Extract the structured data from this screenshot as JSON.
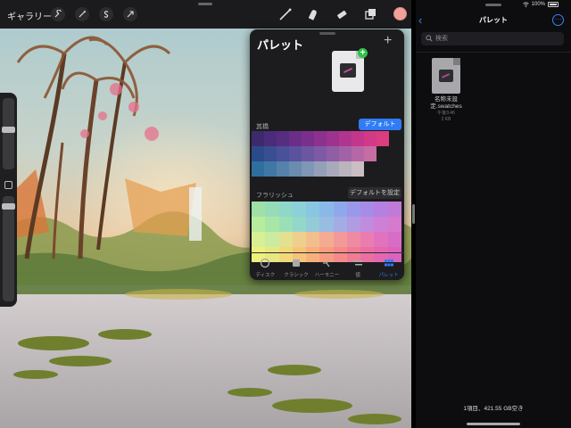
{
  "canvas_app": {
    "gallery_label": "ギャラリー",
    "actions_icons": [
      "wrench-icon",
      "magic-wand-icon",
      "selection-s-icon",
      "transform-arrow-icon"
    ],
    "tools_icons": [
      "brush-icon",
      "smudge-icon",
      "eraser-icon",
      "layers-icon"
    ],
    "current_color": "#f0a29a"
  },
  "palette_panel": {
    "title": "パレット",
    "add_symbol": "+",
    "section1_label": "其橋",
    "section1_button": "デフォルト",
    "section2_label": "フラリッシュ",
    "section2_button": "デフォルトを設定",
    "grid1_colors": [
      [
        "#3d2a6d",
        "#4a2c7a",
        "#572d82",
        "#6a2e88",
        "#7b2f8c",
        "#8c318e",
        "#9d338f",
        "#b0358e",
        "#c2378b",
        "#d13a86",
        "#db3d80",
        "#1c1c1e"
      ],
      [
        "#2b4a8a",
        "#3a4e92",
        "#4a5099",
        "#5a529e",
        "#6c56a2",
        "#7e5aa4",
        "#905ea5",
        "#a263a6",
        "#b568a5",
        "#c66da3",
        "#1c1c1e",
        "#1c1c1e"
      ],
      [
        "#2f6f9e",
        "#3f78a4",
        "#5482aa",
        "#698caf",
        "#7f96b4",
        "#94a0b8",
        "#a8aabb",
        "#bab4be",
        "#cabec2",
        "#1c1c1e",
        "#1c1c1e",
        "#1c1c1e"
      ]
    ],
    "grid2_colors": [
      [
        "#9fe0a6",
        "#97dcb8",
        "#8fd8c9",
        "#8ad1d8",
        "#88c6e2",
        "#8ab9e8",
        "#8fa8eb",
        "#9a98ea",
        "#a88be6",
        "#b580e0",
        "#c27ad8"
      ],
      [
        "#b7ec9c",
        "#a8e6a6",
        "#9bdfb9",
        "#93d7cb",
        "#93cbd9",
        "#98bde2",
        "#a3ace5",
        "#b19be3",
        "#c08cde",
        "#cd80d6",
        "#d779cd"
      ],
      [
        "#d9ef93",
        "#c9eca0",
        "#e3e08f",
        "#efcf8d",
        "#f3be8e",
        "#f4ab92",
        "#f39a99",
        "#ef8aa3",
        "#e97cb0",
        "#e172bd",
        "#d86dc6"
      ],
      [
        "#eef07e",
        "#e7e882",
        "#f2d87c",
        "#f6c47a",
        "#f7b07c",
        "#f69d80",
        "#f48b88",
        "#f07c93",
        "#ea70a2",
        "#e368b1",
        "#db63bd"
      ]
    ],
    "tabs": [
      {
        "label": "ディスク",
        "icon": "disc-icon"
      },
      {
        "label": "クラシック",
        "icon": "square-icon"
      },
      {
        "label": "ハーモニー",
        "icon": "harmony-icon"
      },
      {
        "label": "値",
        "icon": "sliders-icon"
      },
      {
        "label": "パレット",
        "icon": "grid-icon"
      }
    ],
    "active_tab": "パレット"
  },
  "files_app": {
    "status": {
      "battery": "100%"
    },
    "title": "パレット",
    "search_placeholder": "検索",
    "file": {
      "name_line1": "名称未設",
      "name_line2": "定.swatches",
      "time": "午後3:46",
      "size": "2 KB"
    },
    "footer": "1項目、421.55 GB空き"
  }
}
